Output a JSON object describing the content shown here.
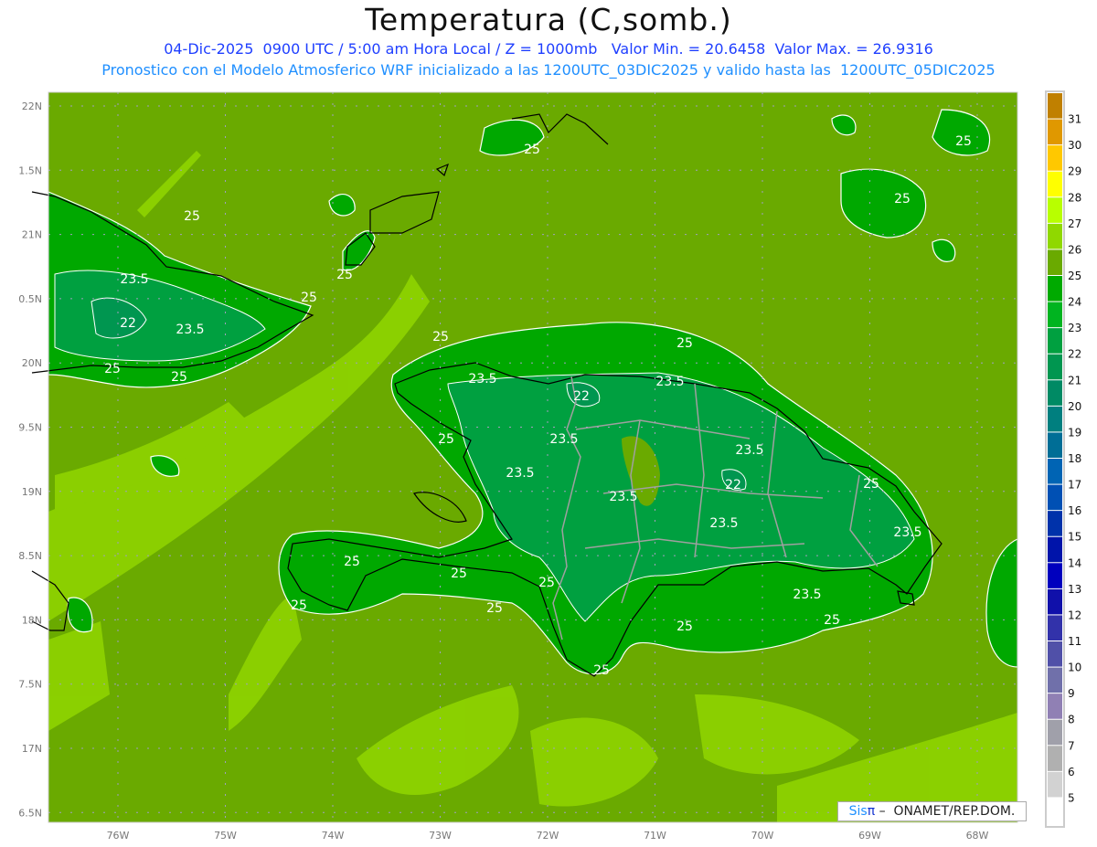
{
  "header": {
    "title": "Temperatura (C,somb.)",
    "line1": "04-Dic-2025  0900 UTC / 5:00 am Hora Local / Z = 1000mb   Valor Min. = 20.6458  Valor Max. = 26.9316",
    "line2": "Pronostico con el Modelo Atmosferico WRF inicializado a las 1200UTC_03DIC2025 y valido hasta las  1200UTC_05DIC2025"
  },
  "axes": {
    "lon_labels": [
      "76W",
      "75W",
      "74W",
      "73W",
      "72W",
      "71W",
      "70W",
      "69W",
      "68W"
    ],
    "lat_labels": [
      "22N",
      "1.5N",
      "21N",
      "0.5N",
      "20N",
      "9.5N",
      "19N",
      "8.5N",
      "18N",
      "7.5N",
      "17N",
      "6.5N"
    ]
  },
  "colorbar": {
    "labels": [
      "31",
      "30",
      "29",
      "28",
      "27",
      "26",
      "25",
      "24",
      "23",
      "22",
      "21",
      "20",
      "19",
      "18",
      "17",
      "16",
      "15",
      "14",
      "13",
      "12",
      "11",
      "10",
      "9",
      "8",
      "7",
      "6",
      "5"
    ],
    "colors": [
      "#c08000",
      "#e09800",
      "#ffc800",
      "#ffff00",
      "#b8ff00",
      "#90d800",
      "#6aaa00",
      "#00aa00",
      "#00b420",
      "#00a040",
      "#009650",
      "#008a64",
      "#007f7f",
      "#006e96",
      "#0064b4",
      "#0050b4",
      "#0032aa",
      "#0014aa",
      "#0000be",
      "#1010aa",
      "#3232aa",
      "#5050a8",
      "#7070aa",
      "#9080b4",
      "#a0a0aa",
      "#b0b0b0",
      "#d2d2d2",
      "#ffffff"
    ]
  },
  "contour_labels": [
    "25",
    "25",
    "25",
    "23.5",
    "22",
    "23.5",
    "25",
    "25",
    "25",
    "25",
    "25",
    "25",
    "25",
    "23.5",
    "22",
    "23.5",
    "25",
    "23.5",
    "23.5",
    "23.5",
    "22",
    "23.5",
    "25",
    "23.5",
    "23.5",
    "25",
    "25",
    "25",
    "25",
    "25",
    "23.5",
    "25",
    "25",
    "25"
  ],
  "credit": {
    "sis": "Sis",
    "pi": "π",
    "rest": " –  ONAMET/REP.DOM."
  }
}
